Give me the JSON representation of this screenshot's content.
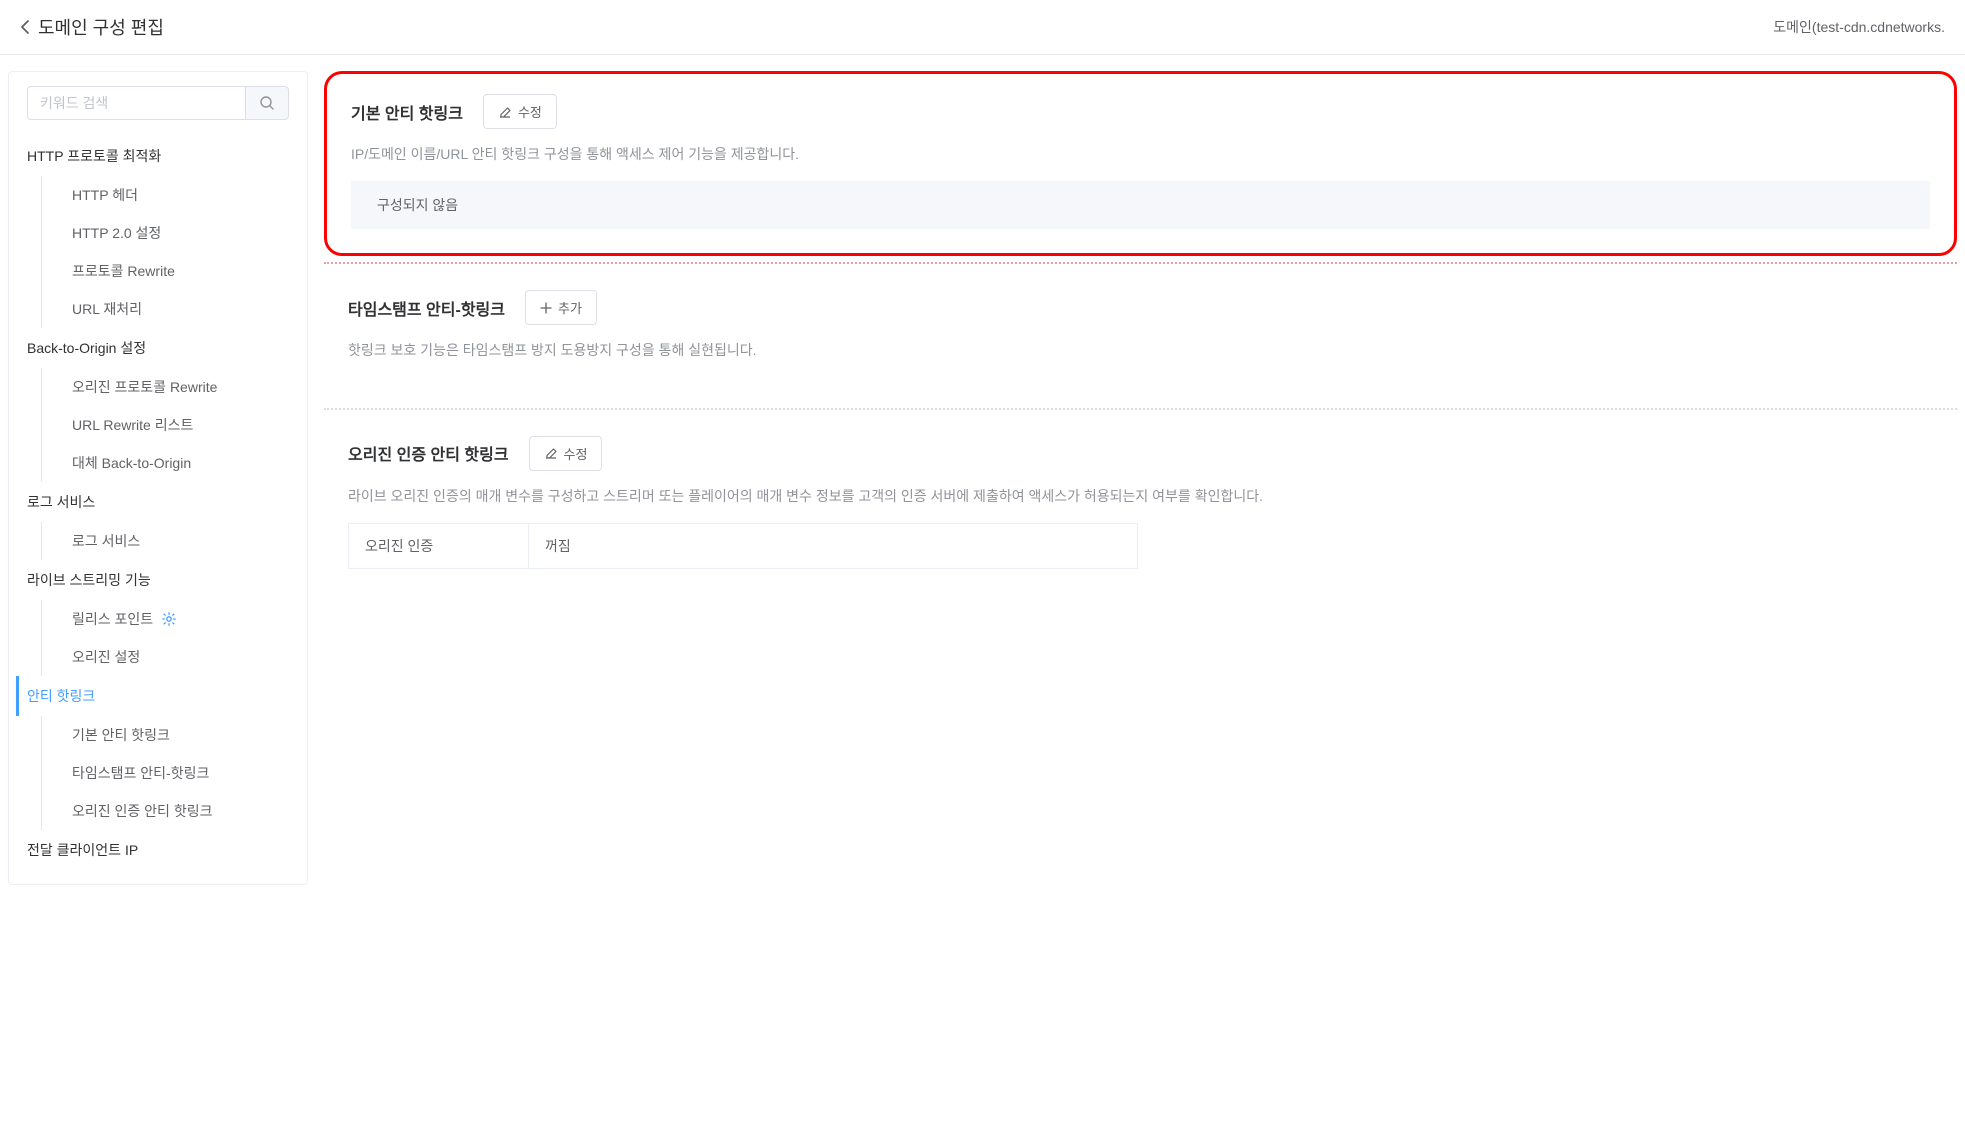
{
  "header": {
    "title": "도메인 구성 편집",
    "domain_label": "도메인(test-cdn.cdnetworks."
  },
  "sidebar": {
    "search_placeholder": "키워드 검색",
    "groups": [
      {
        "title": "HTTP 프로토콜 최적화",
        "items": [
          "HTTP 헤더",
          "HTTP 2.0 설정",
          "프로토콜 Rewrite",
          "URL 재처리"
        ]
      },
      {
        "title": "Back-to-Origin 설정",
        "items": [
          "오리진 프로토콜 Rewrite",
          "URL Rewrite 리스트",
          "대체 Back-to-Origin"
        ]
      },
      {
        "title": "로그 서비스",
        "items": [
          "로그 서비스"
        ]
      },
      {
        "title": "라이브 스트리밍 기능",
        "items": [
          "릴리스 포인트",
          "오리진 설정"
        ]
      },
      {
        "title": "안티 핫링크",
        "active": true,
        "items": [
          "기본 안티 핫링크",
          "타임스탬프 안티-핫링크",
          "오리진 인증 안티 핫링크"
        ]
      },
      {
        "title": "전달 클라이언트 IP",
        "items": []
      }
    ]
  },
  "main": {
    "basic_anti_hotlink": {
      "title": "기본 안티 핫링크",
      "edit_label": "수정",
      "desc": "IP/도메인 이름/URL 안티 핫링크 구성을 통해 액세스 제어 기능을 제공합니다.",
      "status": "구성되지 않음"
    },
    "timestamp_anti_hotlink": {
      "title": "타임스탬프 안티-핫링크",
      "add_label": "추가",
      "desc": "핫링크 보호 기능은 타임스탬프 방지 도용방지 구성을 통해 실현됩니다."
    },
    "origin_auth_anti_hotlink": {
      "title": "오리진 인증 안티 핫링크",
      "edit_label": "수정",
      "desc": "라이브 오리진 인증의 매개 변수를 구성하고 스트리머 또는 플레이어의 매개 변수 정보를 고객의 인증 서버에 제출하여 액세스가 허용되는지 여부를 확인합니다.",
      "table_key": "오리진 인증",
      "table_value": "꺼짐"
    }
  }
}
